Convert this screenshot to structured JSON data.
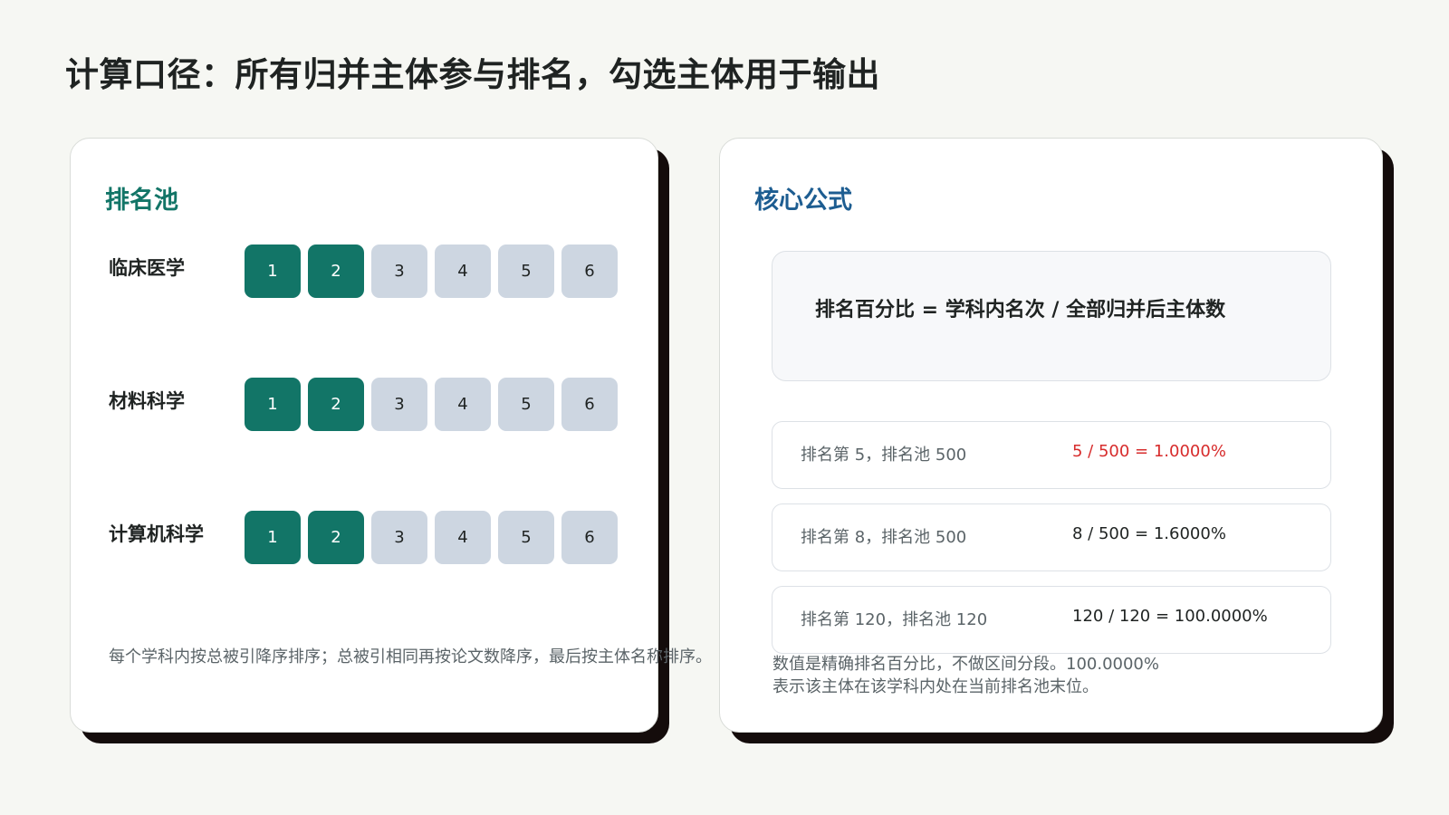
{
  "title": "计算口径：所有归并主体参与排名，勾选主体用于输出",
  "pool_card": {
    "heading": "排名池",
    "rows": [
      {
        "label": "临床医学",
        "slots": [
          "1",
          "2",
          "3",
          "4",
          "5",
          "6"
        ],
        "selected_count": 2
      },
      {
        "label": "材料科学",
        "slots": [
          "1",
          "2",
          "3",
          "4",
          "5",
          "6"
        ],
        "selected_count": 2
      },
      {
        "label": "计算机科学",
        "slots": [
          "1",
          "2",
          "3",
          "4",
          "5",
          "6"
        ],
        "selected_count": 2
      }
    ],
    "note": "每个学科内按总被引降序排序；总被引相同再按论文数降序，最后按主体名称排序。"
  },
  "formula_card": {
    "heading": "核心公式",
    "formula": "排名百分比 = 学科内名次 / 全部归并后主体数",
    "examples": [
      {
        "label": "排名第 5，排名池 500",
        "result": "5 / 500 = 1.0000%",
        "highlight": true
      },
      {
        "label": "排名第 8，排名池 500",
        "result": "8 / 500 = 1.6000%",
        "highlight": false
      },
      {
        "label": "排名第 120，排名池 120",
        "result": "120 / 120 = 100.0000%",
        "highlight": false
      }
    ],
    "note_line1": "数值是精确排名百分比，不做区间分段。100.0000%",
    "note_line2": "表示该主体在该学科内处在当前排名池末位。"
  },
  "colors": {
    "selected_slot": "#127567",
    "unselected_slot": "#cdd6e1",
    "pool_heading": "#127567",
    "formula_heading": "#1d5d91",
    "highlight_result": "#d72c2c"
  }
}
